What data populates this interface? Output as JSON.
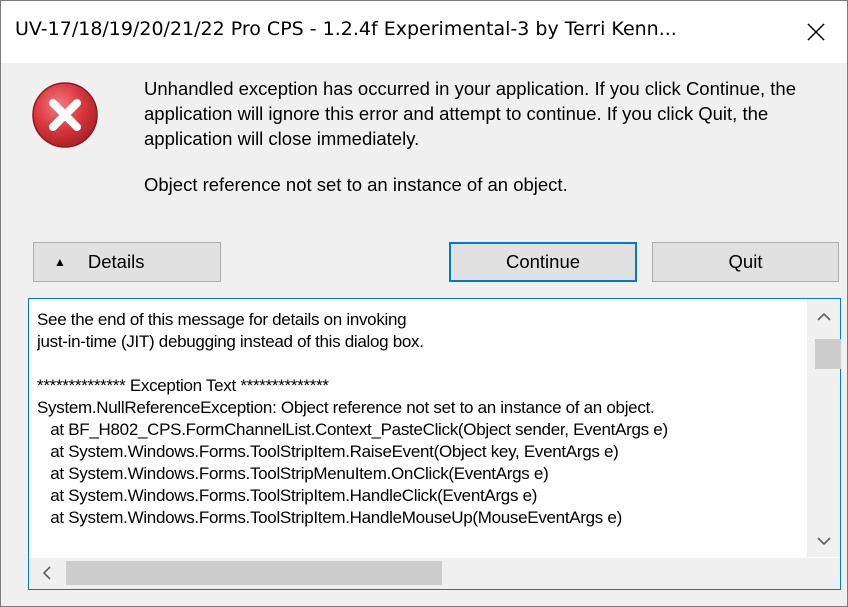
{
  "window": {
    "title": "UV-17/18/19/20/21/22 Pro CPS - 1.2.4f Experimental-3 by Terri Kenn..."
  },
  "icons": {
    "error": "error-icon",
    "close": "close-icon"
  },
  "message": {
    "main": "Unhandled exception has occurred in your application. If you click Continue, the application will ignore this error and attempt to continue. If you click Quit, the application will close immediately.",
    "detail": "Object reference not set to an instance of an object."
  },
  "buttons": {
    "details": "Details",
    "continue": "Continue",
    "quit": "Quit"
  },
  "details_text": "See the end of this message for details on invoking\njust-in-time (JIT) debugging instead of this dialog box.\n\n************** Exception Text **************\nSystem.NullReferenceException: Object reference not set to an instance of an object.\n   at BF_H802_CPS.FormChannelList.Context_PasteClick(Object sender, EventArgs e)\n   at System.Windows.Forms.ToolStripItem.RaiseEvent(Object key, EventArgs e)\n   at System.Windows.Forms.ToolStripMenuItem.OnClick(EventArgs e)\n   at System.Windows.Forms.ToolStripItem.HandleClick(EventArgs e)\n   at System.Windows.Forms.ToolStripItem.HandleMouseUp(MouseEventArgs e)",
  "colors": {
    "accent": "#0078d7",
    "error_red": "#d0343a"
  }
}
